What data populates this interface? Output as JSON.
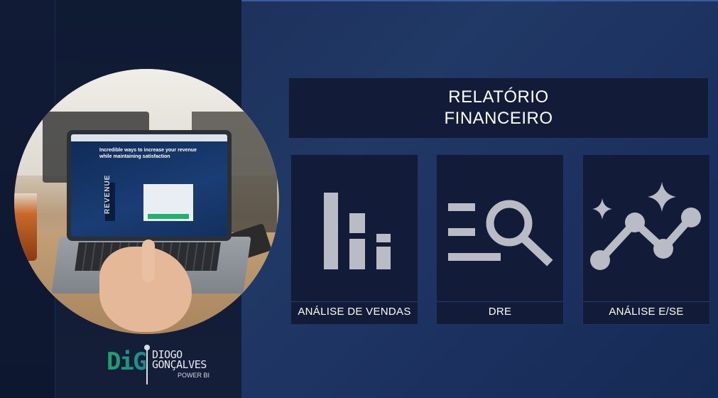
{
  "title": {
    "line1": "RELATÓRIO",
    "line2": "FINANCEIRO"
  },
  "cards": [
    {
      "label": "ANÁLISE DE VENDAS",
      "icon": "bar-chart-icon"
    },
    {
      "label": "DRE",
      "icon": "search-list-icon"
    },
    {
      "label": "ANÁLISE E/SE",
      "icon": "trend-sparkle-icon"
    }
  ],
  "photo": {
    "headline": "Incredible ways to increase your revenue while maintaining satisfaction",
    "side_text": "REVENUE"
  },
  "logo": {
    "mark": "DiG",
    "line1": "DIOGO",
    "line2": "GONÇALVES",
    "line3": "POWER BI"
  },
  "colors": {
    "panel": "#121c38",
    "icon": "#b9bcc4",
    "text": "#ffffff",
    "brand_green": "#22a06b"
  }
}
